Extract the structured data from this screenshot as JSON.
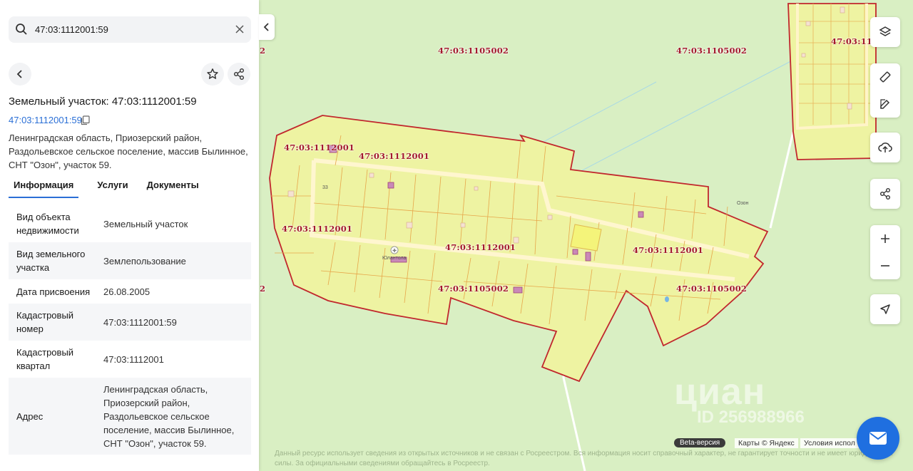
{
  "search": {
    "value": "47:03:1112001:59"
  },
  "object": {
    "title": "Земельный участок: 47:03:1112001:59",
    "cadastral_link": "47:03:1112001:59",
    "address_lines": [
      "Ленинградская область, Приозерский район,",
      "Раздольевское сельское поселение, массив Былинное,",
      "СНТ \"Озон\", участок 59."
    ]
  },
  "tabs": [
    {
      "label": "Информация",
      "active": true
    },
    {
      "label": "Услуги",
      "active": false
    },
    {
      "label": "Документы",
      "active": false
    }
  ],
  "info_rows": [
    {
      "key_lines": [
        "Вид объекта",
        "недвижимости"
      ],
      "value_lines": [
        "Земельный участок"
      ]
    },
    {
      "key_lines": [
        "Вид земельного",
        "участка"
      ],
      "value_lines": [
        "Землепользование"
      ]
    },
    {
      "key_lines": [
        "Дата присвоения"
      ],
      "value_lines": [
        "26.08.2005"
      ]
    },
    {
      "key_lines": [
        "Кадастровый",
        "номер"
      ],
      "value_lines": [
        "47:03:1112001:59"
      ]
    },
    {
      "key_lines": [
        "Кадастровый",
        "квартал"
      ],
      "value_lines": [
        "47:03:1112001"
      ]
    },
    {
      "key_lines": [
        "Адрес"
      ],
      "value_lines": [
        "Ленинградская область,",
        "Приозерский район,",
        "Раздольевское сельское",
        "поселение, массив Былинное,",
        "СНТ \"Озон\", участок 59."
      ]
    }
  ],
  "map": {
    "labels": [
      "47:03:1105002",
      "47:03:1105002",
      "47:03:11",
      "47:03:1112001",
      "47:03:1112001",
      "47:03:1112001",
      "47:03:1112001",
      "47:03:1112001",
      "47:03:1105002",
      "47:03:1105002",
      "2",
      "2"
    ],
    "place_labels": [
      "Юлантола",
      "Озон",
      "33"
    ],
    "beta_label": "Beta-версия",
    "copyright": "Карты © Яндекс",
    "terms": "Условия испол",
    "disclaimer": "Данный ресурс использует сведения из открытых источников и не связан с Росреестром. Вся информация носит справочный характер, не гарантирует точности и не имеет юридической силы. За официальными сведениями обращайтесь в Росреестр.",
    "watermark": "циан",
    "watermark_id": "ID 256988966"
  },
  "colors": {
    "map_bg": "#d9efc3",
    "parcel_fill": "#eef3a2",
    "parcel_border": "#c1272d",
    "label": "#a31a2c",
    "accent": "#2a6fd6",
    "mail_button": "#1f6fe0"
  }
}
